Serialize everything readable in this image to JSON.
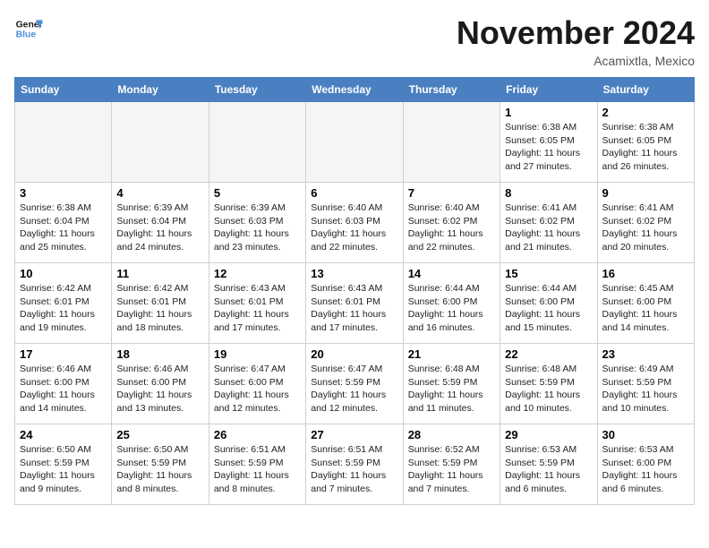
{
  "header": {
    "logo_line1": "General",
    "logo_line2": "Blue",
    "month": "November 2024",
    "location": "Acamixtla, Mexico"
  },
  "weekdays": [
    "Sunday",
    "Monday",
    "Tuesday",
    "Wednesday",
    "Thursday",
    "Friday",
    "Saturday"
  ],
  "weeks": [
    [
      {
        "day": "",
        "info": ""
      },
      {
        "day": "",
        "info": ""
      },
      {
        "day": "",
        "info": ""
      },
      {
        "day": "",
        "info": ""
      },
      {
        "day": "",
        "info": ""
      },
      {
        "day": "1",
        "info": "Sunrise: 6:38 AM\nSunset: 6:05 PM\nDaylight: 11 hours and 27 minutes."
      },
      {
        "day": "2",
        "info": "Sunrise: 6:38 AM\nSunset: 6:05 PM\nDaylight: 11 hours and 26 minutes."
      }
    ],
    [
      {
        "day": "3",
        "info": "Sunrise: 6:38 AM\nSunset: 6:04 PM\nDaylight: 11 hours and 25 minutes."
      },
      {
        "day": "4",
        "info": "Sunrise: 6:39 AM\nSunset: 6:04 PM\nDaylight: 11 hours and 24 minutes."
      },
      {
        "day": "5",
        "info": "Sunrise: 6:39 AM\nSunset: 6:03 PM\nDaylight: 11 hours and 23 minutes."
      },
      {
        "day": "6",
        "info": "Sunrise: 6:40 AM\nSunset: 6:03 PM\nDaylight: 11 hours and 22 minutes."
      },
      {
        "day": "7",
        "info": "Sunrise: 6:40 AM\nSunset: 6:02 PM\nDaylight: 11 hours and 22 minutes."
      },
      {
        "day": "8",
        "info": "Sunrise: 6:41 AM\nSunset: 6:02 PM\nDaylight: 11 hours and 21 minutes."
      },
      {
        "day": "9",
        "info": "Sunrise: 6:41 AM\nSunset: 6:02 PM\nDaylight: 11 hours and 20 minutes."
      }
    ],
    [
      {
        "day": "10",
        "info": "Sunrise: 6:42 AM\nSunset: 6:01 PM\nDaylight: 11 hours and 19 minutes."
      },
      {
        "day": "11",
        "info": "Sunrise: 6:42 AM\nSunset: 6:01 PM\nDaylight: 11 hours and 18 minutes."
      },
      {
        "day": "12",
        "info": "Sunrise: 6:43 AM\nSunset: 6:01 PM\nDaylight: 11 hours and 17 minutes."
      },
      {
        "day": "13",
        "info": "Sunrise: 6:43 AM\nSunset: 6:01 PM\nDaylight: 11 hours and 17 minutes."
      },
      {
        "day": "14",
        "info": "Sunrise: 6:44 AM\nSunset: 6:00 PM\nDaylight: 11 hours and 16 minutes."
      },
      {
        "day": "15",
        "info": "Sunrise: 6:44 AM\nSunset: 6:00 PM\nDaylight: 11 hours and 15 minutes."
      },
      {
        "day": "16",
        "info": "Sunrise: 6:45 AM\nSunset: 6:00 PM\nDaylight: 11 hours and 14 minutes."
      }
    ],
    [
      {
        "day": "17",
        "info": "Sunrise: 6:46 AM\nSunset: 6:00 PM\nDaylight: 11 hours and 14 minutes."
      },
      {
        "day": "18",
        "info": "Sunrise: 6:46 AM\nSunset: 6:00 PM\nDaylight: 11 hours and 13 minutes."
      },
      {
        "day": "19",
        "info": "Sunrise: 6:47 AM\nSunset: 6:00 PM\nDaylight: 11 hours and 12 minutes."
      },
      {
        "day": "20",
        "info": "Sunrise: 6:47 AM\nSunset: 5:59 PM\nDaylight: 11 hours and 12 minutes."
      },
      {
        "day": "21",
        "info": "Sunrise: 6:48 AM\nSunset: 5:59 PM\nDaylight: 11 hours and 11 minutes."
      },
      {
        "day": "22",
        "info": "Sunrise: 6:48 AM\nSunset: 5:59 PM\nDaylight: 11 hours and 10 minutes."
      },
      {
        "day": "23",
        "info": "Sunrise: 6:49 AM\nSunset: 5:59 PM\nDaylight: 11 hours and 10 minutes."
      }
    ],
    [
      {
        "day": "24",
        "info": "Sunrise: 6:50 AM\nSunset: 5:59 PM\nDaylight: 11 hours and 9 minutes."
      },
      {
        "day": "25",
        "info": "Sunrise: 6:50 AM\nSunset: 5:59 PM\nDaylight: 11 hours and 8 minutes."
      },
      {
        "day": "26",
        "info": "Sunrise: 6:51 AM\nSunset: 5:59 PM\nDaylight: 11 hours and 8 minutes."
      },
      {
        "day": "27",
        "info": "Sunrise: 6:51 AM\nSunset: 5:59 PM\nDaylight: 11 hours and 7 minutes."
      },
      {
        "day": "28",
        "info": "Sunrise: 6:52 AM\nSunset: 5:59 PM\nDaylight: 11 hours and 7 minutes."
      },
      {
        "day": "29",
        "info": "Sunrise: 6:53 AM\nSunset: 5:59 PM\nDaylight: 11 hours and 6 minutes."
      },
      {
        "day": "30",
        "info": "Sunrise: 6:53 AM\nSunset: 6:00 PM\nDaylight: 11 hours and 6 minutes."
      }
    ]
  ]
}
